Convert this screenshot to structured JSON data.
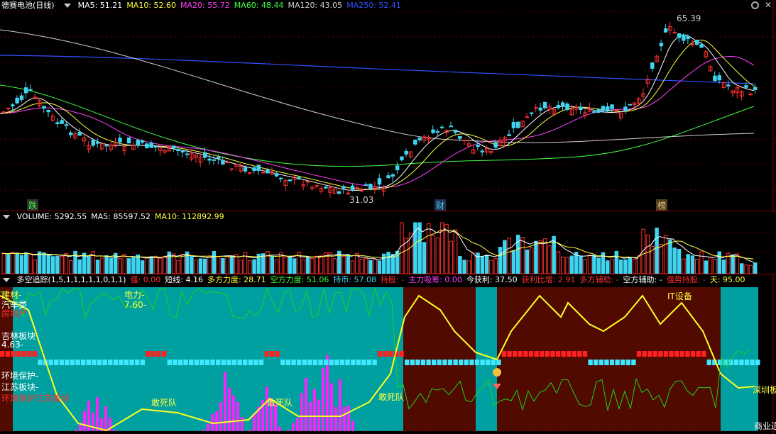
{
  "colors": {
    "up": "#ff3030",
    "down": "#3fd4f0",
    "ma5": "#ffffff",
    "ma10": "#ffff40",
    "ma20": "#ff40ff",
    "ma60": "#40ff40",
    "ma120": "#d0d0d0",
    "ma250": "#3050ff",
    "teal_zone": "#00a0a0",
    "brown_zone": "#500a00",
    "yellow_line": "#ffff20",
    "green_line": "#20d020",
    "magenta_bar": "#ff20ff"
  },
  "price_panel": {
    "title": "德赛电池(日线)",
    "indicators": [
      {
        "label": "MA5: 51.21",
        "color": "#ffffff"
      },
      {
        "label": "MA10: 52.60",
        "color": "#ffff40"
      },
      {
        "label": "MA20: 55.72",
        "color": "#ff40ff"
      },
      {
        "label": "MA60: 48.44",
        "color": "#40ff40"
      },
      {
        "label": "MA120: 43.05",
        "color": "#d0d0d0"
      },
      {
        "label": "MA250: 52.41",
        "color": "#3050ff"
      }
    ],
    "high_label": "65.39",
    "low_label": "31.03",
    "markers": [
      {
        "text": "跌",
        "color": "#40ff40"
      },
      {
        "text": "财",
        "color": "#3fd4f0"
      },
      {
        "text": "榜",
        "color": "#f0c080"
      }
    ]
  },
  "volume_panel": {
    "items": [
      {
        "label": "VOLUME: 5292.55",
        "color": "#ffffff"
      },
      {
        "label": "MA5: 85597.52",
        "color": "#ffffff"
      },
      {
        "label": "MA10: 112892.99",
        "color": "#ffff40"
      }
    ]
  },
  "signal_panel": {
    "items": [
      {
        "label": "多空追踪(1,5,1,1,1,1,1,0,1,1)",
        "color": "#ffffff"
      },
      {
        "label": "强: 0.00",
        "color": "#ff3030"
      },
      {
        "label": "短线: 4.16",
        "color": "#ffffff"
      },
      {
        "label": "多方力度: 28.71",
        "color": "#ffff40"
      },
      {
        "label": "空方力度: 51.06",
        "color": "#40ff40"
      },
      {
        "label": "持币: 57.08",
        "color": "#3fd4f0"
      },
      {
        "label": "持股: -",
        "color": "#ff3030"
      },
      {
        "label": "主力吸筹: 0.00",
        "color": "#ff40ff"
      },
      {
        "label": "今获利: 37.50",
        "color": "#ffffff"
      },
      {
        "label": "获利比增: 2.91",
        "color": "#ff3030"
      },
      {
        "label": "多方辅助: -",
        "color": "#ff3030"
      },
      {
        "label": "空方辅助: -",
        "color": "#ffffff"
      },
      {
        "label": "强势持股: -",
        "color": "#ff3030"
      },
      {
        "label": "天: 95.00",
        "color": "#ffff40"
      }
    ],
    "texts": [
      {
        "text": "建材-",
        "color": "#ffff40"
      },
      {
        "text": "汽车类",
        "color": "#ffffff"
      },
      {
        "text": "房地产",
        "color": "#ff3030"
      },
      {
        "text": "电力-",
        "color": "#ffff40"
      },
      {
        "text": "7.60-",
        "color": "#ffff40"
      },
      {
        "text": "吉林板块",
        "color": "#ffffff"
      },
      {
        "text": "4.63-",
        "color": "#ffffff"
      },
      {
        "text": "环境保护-",
        "color": "#ffffff"
      },
      {
        "text": "江苏板块-",
        "color": "#ffffff"
      },
      {
        "text": "环境保护江苏板块",
        "color": "#ff3030"
      },
      {
        "text": "敢死队",
        "color": "#ffff40"
      },
      {
        "text": "敢死队",
        "color": "#ffff40"
      },
      {
        "text": "敢死队",
        "color": "#ffff40"
      },
      {
        "text": "IT设备",
        "color": "#ffff40"
      },
      {
        "text": "深圳板",
        "color": "#ffff40"
      },
      {
        "text": "商业连",
        "color": "#ffffff"
      }
    ]
  }
}
